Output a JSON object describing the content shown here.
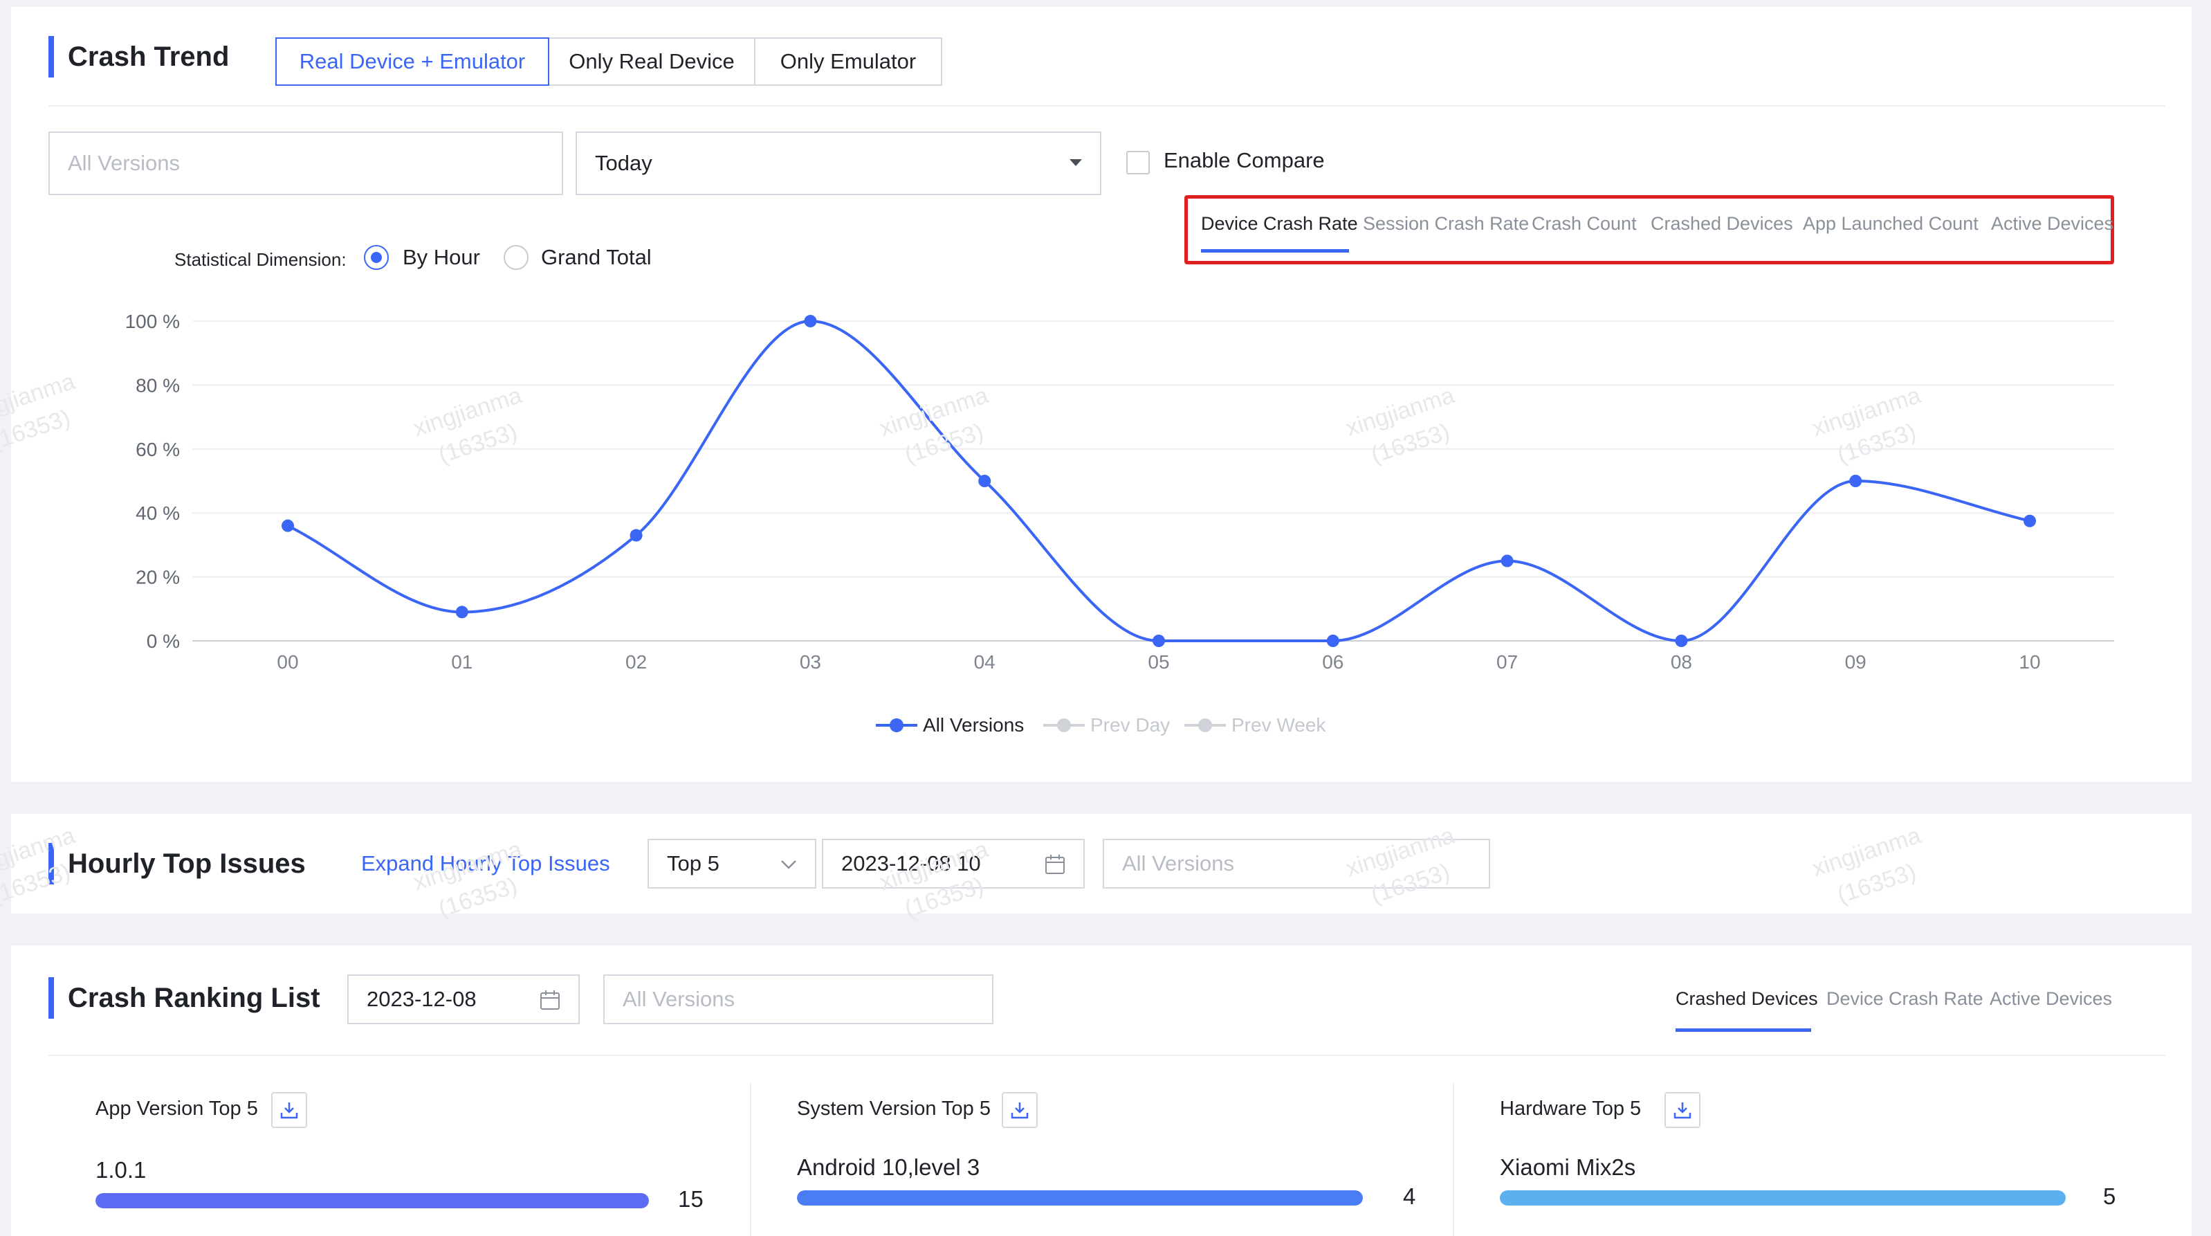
{
  "watermark": {
    "line1": "xingjianma",
    "line2": "(16353)"
  },
  "crash_trend": {
    "title": "Crash Trend",
    "device_filter": [
      "Real Device + Emulator",
      "Only Real Device",
      "Only Emulator"
    ],
    "versions_placeholder": "All Versions",
    "date_range": "Today",
    "enable_compare": "Enable Compare",
    "dimension_label": "Statistical Dimension:",
    "dimension_by_hour": "By Hour",
    "dimension_grand_total": "Grand Total",
    "metric_tabs": [
      "Device Crash Rate",
      "Session Crash Rate",
      "Crash Count",
      "Crashed Devices",
      "App Launched Count",
      "Active Devices"
    ],
    "legend": [
      "All Versions",
      "Prev Day",
      "Prev Week"
    ]
  },
  "chart_data": {
    "type": "line",
    "x": [
      "00",
      "01",
      "02",
      "03",
      "04",
      "05",
      "06",
      "07",
      "08",
      "09",
      "10"
    ],
    "y_ticks": [
      "100 %",
      "80 %",
      "60 %",
      "40 %",
      "20 %",
      "0 %"
    ],
    "ylim": [
      0,
      100
    ],
    "series": [
      {
        "name": "All Versions",
        "values": [
          36,
          9,
          33,
          100,
          50,
          0,
          0,
          25,
          0,
          50,
          37.5
        ],
        "color": "#3b66f5"
      }
    ],
    "smooth": true,
    "grid": true,
    "legend_position": "bottom"
  },
  "hourly_top": {
    "title": "Hourly Top Issues",
    "expand_link": "Expand Hourly Top Issues",
    "top_select": "Top 5",
    "datetime": "2023-12-08 10",
    "versions_placeholder": "All Versions"
  },
  "ranking": {
    "title": "Crash Ranking List",
    "date": "2023-12-08",
    "versions_placeholder": "All Versions",
    "tabs": [
      "Crashed Devices",
      "Device Crash Rate",
      "Active Devices"
    ],
    "columns": [
      {
        "title": "App Version Top 5",
        "item": "1.0.1",
        "value": "15",
        "fraction": 1.0,
        "color": "#5b6cf2"
      },
      {
        "title": "System Version Top 5",
        "item": "Android 10,level 3",
        "value": "4",
        "fraction": 1.0,
        "color": "#4a7cf3"
      },
      {
        "title": "Hardware Top 5",
        "item": "Xiaomi Mix2s",
        "value": "5",
        "fraction": 1.0,
        "color": "#5bb0f0"
      }
    ]
  },
  "colors": {
    "accent": "#3b66f5",
    "highlight_box": "#e02020"
  }
}
